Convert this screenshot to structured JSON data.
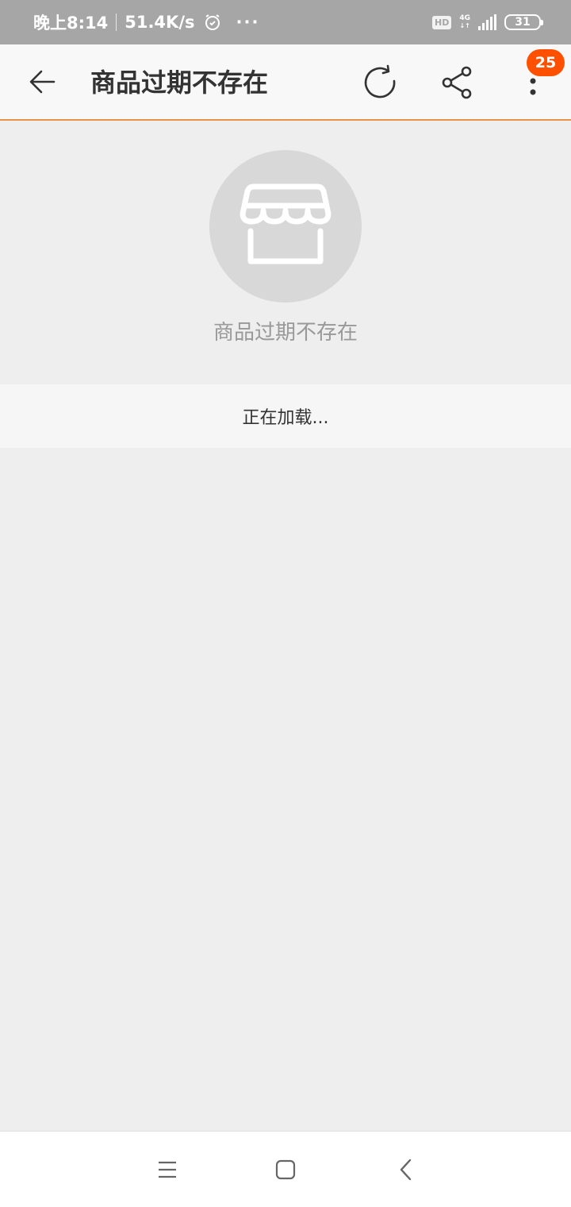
{
  "status_bar": {
    "time": "晚上8:14",
    "speed": "51.4K/s",
    "alarm_icon": "alarm-clock-icon",
    "more_dots": "···",
    "hd": "HD",
    "network": "4G",
    "battery": "31"
  },
  "toolbar": {
    "back_icon": "arrow-left-icon",
    "title": "商品过期不存在",
    "refresh_icon": "refresh-icon",
    "share_icon": "share-icon",
    "more_icon": "more-vertical-icon",
    "badge_count": "25",
    "accent_color": "#e8934a",
    "badge_color": "#ff5000"
  },
  "empty_state": {
    "icon": "store-icon",
    "message": "商品过期不存在"
  },
  "loading": {
    "text": "正在加载..."
  },
  "nav_bar": {
    "menu_icon": "menu-icon",
    "home_icon": "home-square-icon",
    "back_icon": "chevron-left-icon"
  }
}
